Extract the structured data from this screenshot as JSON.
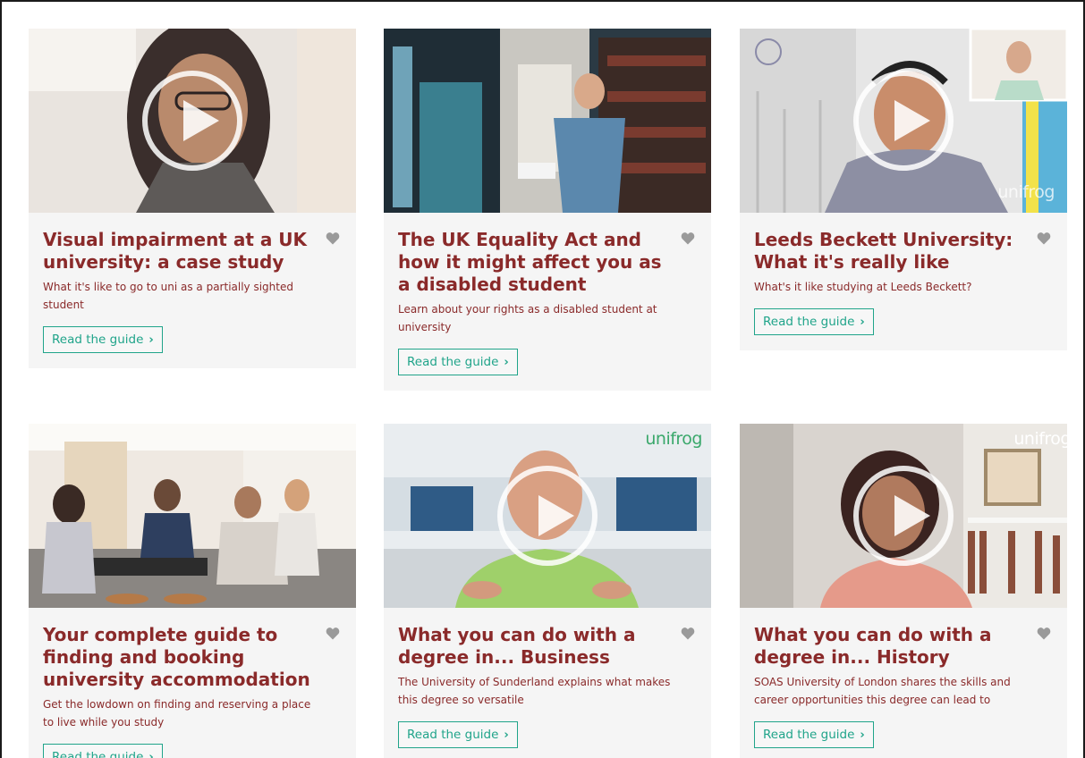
{
  "cards": [
    {
      "title": "Visual impairment at a UK university: a case study",
      "description": "What it's like to go to uni as a partially sighted student",
      "button_label": "Read the guide",
      "button_icon": "chevron-right-icon",
      "favorite_icon": "heart-icon",
      "has_play": true
    },
    {
      "title": "The UK Equality Act and how it might affect you as a disabled student",
      "description": "Learn about your rights as a disabled student at university",
      "button_label": "Read the guide",
      "button_icon": "chevron-right-icon",
      "favorite_icon": "heart-icon",
      "has_play": false
    },
    {
      "title": "Leeds Beckett University: What it's really like",
      "description": "What's it like studying at Leeds Beckett?",
      "button_label": "Read the guide",
      "button_icon": "chevron-right-icon",
      "favorite_icon": "heart-icon",
      "has_play": true,
      "brand": "unifrog"
    },
    {
      "title": "Your complete guide to finding and booking university accommodation",
      "description": "Get the lowdown on finding and reserving a place to live while you study",
      "button_label": "Read the guide",
      "button_icon": "chevron-right-icon",
      "favorite_icon": "heart-icon",
      "has_play": false
    },
    {
      "title": "What you can do with a degree in... Business",
      "description": "The University of Sunderland explains what makes this degree so versatile",
      "button_label": "Read the guide",
      "button_icon": "chevron-right-icon",
      "favorite_icon": "heart-icon",
      "has_play": true,
      "brand": "unifrog"
    },
    {
      "title": "What you can do with a degree in... History",
      "description": "SOAS University of London shares the skills and career opportunities this degree can lead to",
      "button_label": "Read the guide",
      "button_icon": "chevron-right-icon",
      "favorite_icon": "heart-icon",
      "has_play": true,
      "brand": "unifrog"
    }
  ],
  "colors": {
    "title": "#8a2a2a",
    "button": "#20a48a",
    "card_bg": "#f5f5f5",
    "heart": "#9a9a9a"
  }
}
